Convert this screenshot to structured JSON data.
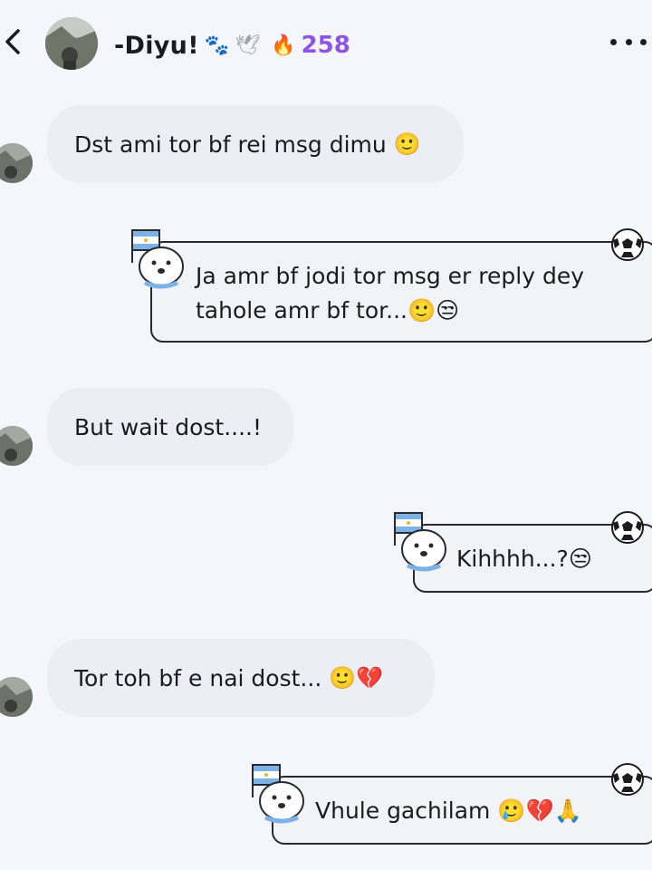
{
  "header": {
    "name": "-Diyu!",
    "streak": "258",
    "icons": [
      "back-icon",
      "paw-icon",
      "dove-icon",
      "flame-icon",
      "more-icon"
    ]
  },
  "messages": [
    {
      "side": "in",
      "text": "Dst ami tor bf rei msg dimu",
      "emoji": "🙂"
    },
    {
      "side": "out",
      "lines": [
        "Ja amr bf jodi tor msg er reply dey",
        "tahole amr bf tor...🙂😒"
      ]
    },
    {
      "side": "in",
      "text": "But wait dost....!",
      "emoji": ""
    },
    {
      "side": "out",
      "lines": [
        "Kihhhh...?😒"
      ]
    },
    {
      "side": "in",
      "text": "Tor toh bf e nai dost...",
      "emoji": "🙂💔"
    },
    {
      "side": "out",
      "lines": [
        "Vhule gachilam 🥲💔🙏"
      ]
    }
  ],
  "colors": {
    "background": "#f5f6fb",
    "incoming_bubble": "#eceef5",
    "streak_accent": "#8d53e8",
    "outline": "#2a2a2e"
  }
}
